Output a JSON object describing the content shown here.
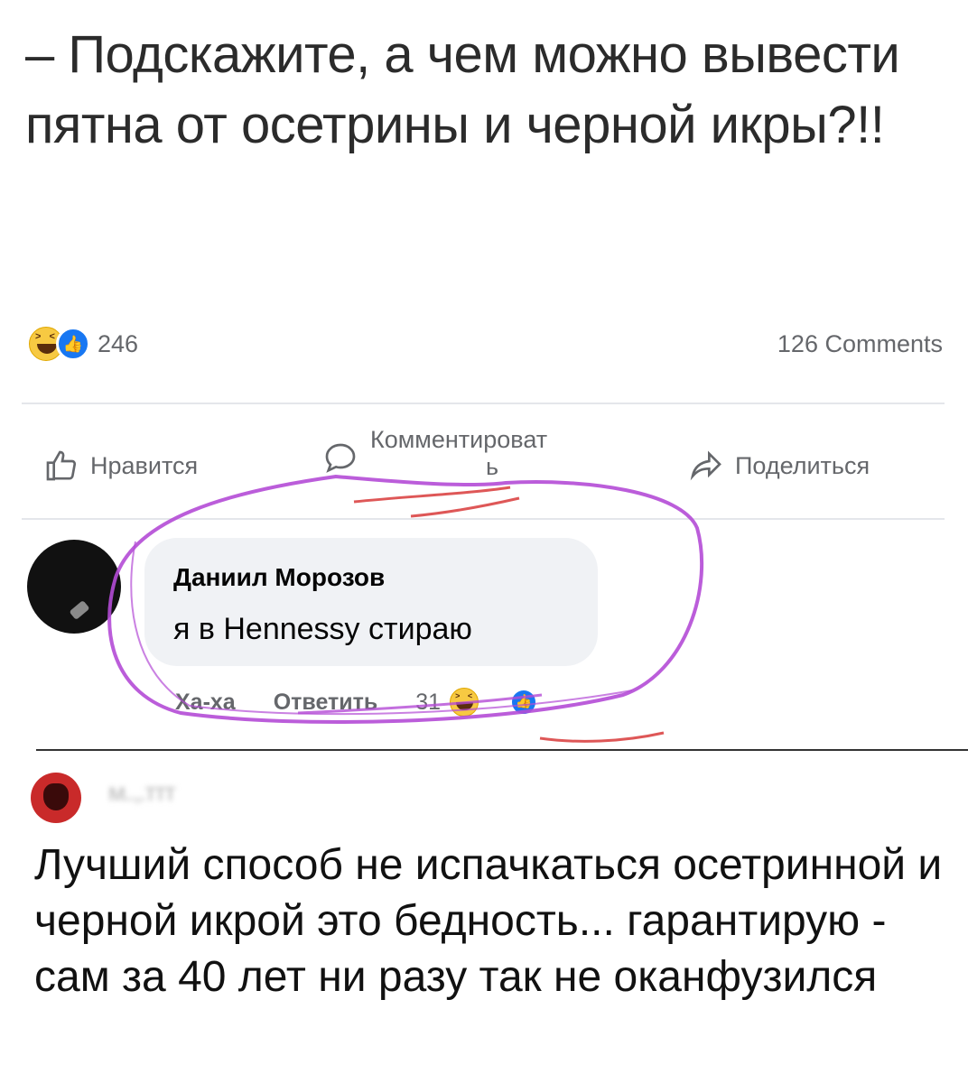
{
  "post": {
    "text": "– Подскажите, а чем можно вывести пятна от осетрины и черной икры?!!",
    "reaction_count": "246",
    "comments_count": "126 Comments",
    "reaction_icons": [
      "haha-emoji-icon",
      "like-badge-icon"
    ]
  },
  "actions": {
    "like_label": "Нравится",
    "comment_label": "Комментироват",
    "comment_wrap": "ь",
    "share_label": "Поделиться"
  },
  "comment": {
    "author": "Даниил Морозов",
    "text": "я в Hennessy стираю",
    "haha_label": "Ха-ха",
    "reply_label": "Ответить",
    "reaction_count": "31"
  },
  "reply": {
    "author_name_blurred": "м..,.ттт",
    "text": "Лучший способ не испачкаться осетринной и черной икрой это бедность... гарантирую - сам за 40 лет ни разу так не оканфузился"
  },
  "colors": {
    "accent": "#1877f2",
    "muted": "#65676b",
    "bubble": "#f0f2f5",
    "marker_purple": "#b44bd6",
    "marker_red": "#d83a3a"
  }
}
